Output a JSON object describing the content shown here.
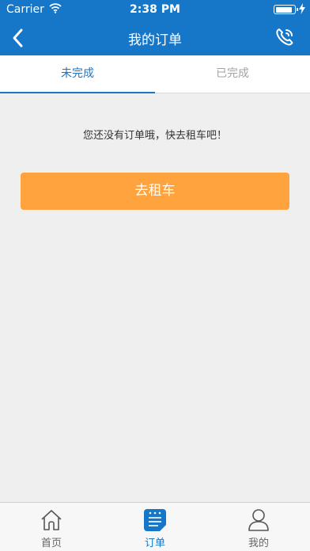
{
  "status_bar": {
    "carrier": "Carrier",
    "time": "2:38 PM",
    "battery_level": 0.95
  },
  "nav": {
    "title": "我的订单",
    "back_icon": "chevron-left-icon",
    "action_icon": "phone-icon"
  },
  "tabs": [
    {
      "label": "未完成",
      "active": true
    },
    {
      "label": "已完成",
      "active": false
    }
  ],
  "empty_state": {
    "message": "您还没有订单哦，快去租车吧！"
  },
  "cta": {
    "label": "去租车"
  },
  "tabbar": [
    {
      "label": "首页",
      "icon": "home-icon",
      "active": false
    },
    {
      "label": "订单",
      "icon": "orders-icon",
      "active": true
    },
    {
      "label": "我的",
      "icon": "profile-icon",
      "active": false
    }
  ],
  "colors": {
    "primary": "#1677c9",
    "accent": "#ffa33e",
    "background": "#efefef"
  }
}
